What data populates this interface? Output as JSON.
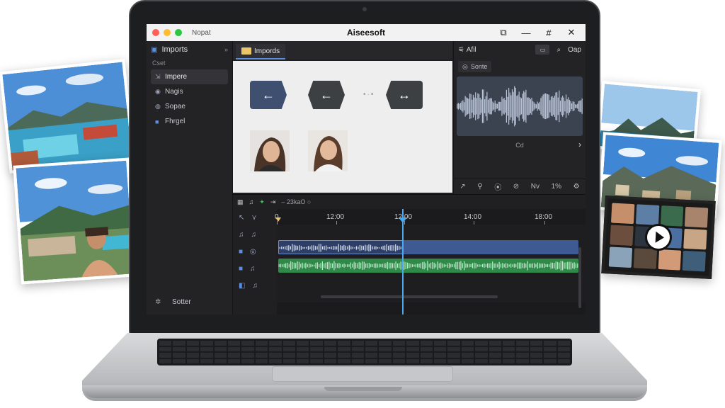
{
  "window": {
    "title": "Aiseesoft",
    "menu_label": "Nopat"
  },
  "window_controls": [
    "⧉",
    "—",
    "#",
    "✕"
  ],
  "sidebar": {
    "header": "Imports",
    "section_label": "Cset",
    "items": [
      {
        "label": "Impere",
        "icon": "import-icon"
      },
      {
        "label": "Nagis",
        "icon": "media-icon"
      },
      {
        "label": "Sopae",
        "icon": "audio-icon"
      },
      {
        "label": "Fhrgel",
        "icon": "effects-icon"
      }
    ],
    "footer": "Sotter"
  },
  "media_tab": {
    "label": "Impords"
  },
  "right_panel": {
    "top_label": "Afil",
    "top_right_label": "Oap",
    "chip_label": "Sonte",
    "wave_caption": "Cd",
    "tools": [
      "↗",
      "⚲",
      "⦿",
      "⊘",
      "Nv",
      "1%",
      "⚙"
    ]
  },
  "timeline": {
    "zoom_label": "23kaO",
    "ruler_ticks": [
      "0",
      "12:00",
      "12:00",
      "14:00",
      "18:00"
    ]
  },
  "colors": {
    "accent_blue": "#4aa8f0",
    "clip_blue": "#3e5a92",
    "clip_green": "#2f8a4a",
    "app_bg": "#1e1e20"
  }
}
